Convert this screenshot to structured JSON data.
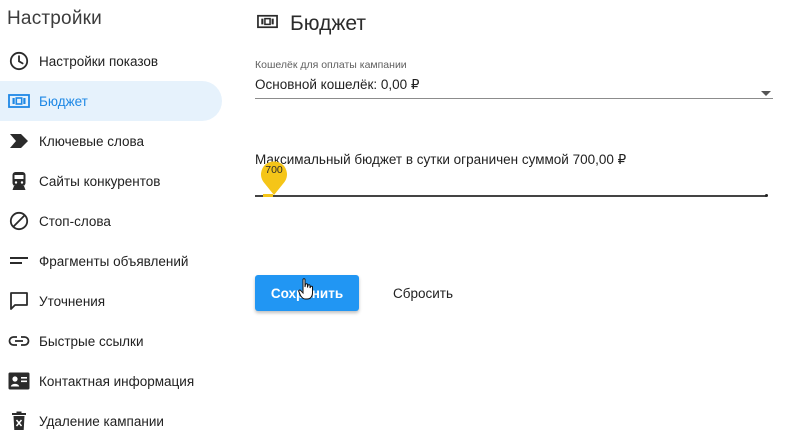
{
  "sidebar": {
    "title": "Настройки",
    "items": [
      {
        "label": "Настройки показов",
        "icon": "clock-icon",
        "active": false
      },
      {
        "label": "Бюджет",
        "icon": "money-icon",
        "active": true
      },
      {
        "label": "Ключевые слова",
        "icon": "label-icon",
        "active": false
      },
      {
        "label": "Сайты конкурентов",
        "icon": "train-icon",
        "active": false
      },
      {
        "label": "Стоп-слова",
        "icon": "block-icon",
        "active": false
      },
      {
        "label": "Фрагменты объявлений",
        "icon": "short-text-icon",
        "active": false
      },
      {
        "label": "Уточнения",
        "icon": "chat-bubble-icon",
        "active": false
      },
      {
        "label": "Быстрые ссылки",
        "icon": "link-icon",
        "active": false
      },
      {
        "label": "Контактная информация",
        "icon": "contact-card-icon",
        "active": false
      },
      {
        "label": "Удаление кампании",
        "icon": "trash-icon",
        "active": false
      }
    ]
  },
  "page": {
    "title": "Бюджет",
    "title_icon": "money-icon"
  },
  "wallet": {
    "caption": "Кошелёк для оплаты кампании",
    "value": "Основной кошелёк: 0,00 ₽"
  },
  "budget": {
    "caption": "Максимальный бюджет в сутки ограничен суммой 700,00 ₽",
    "slider_value": "700",
    "slider_fraction": 0.02
  },
  "buttons": {
    "save": "Сохранить",
    "reset": "Сбросить"
  },
  "colors": {
    "accent": "#2196f3",
    "active_bg": "#e6f2fc",
    "active_text": "#1e88e5",
    "slider": "#f5c518"
  }
}
